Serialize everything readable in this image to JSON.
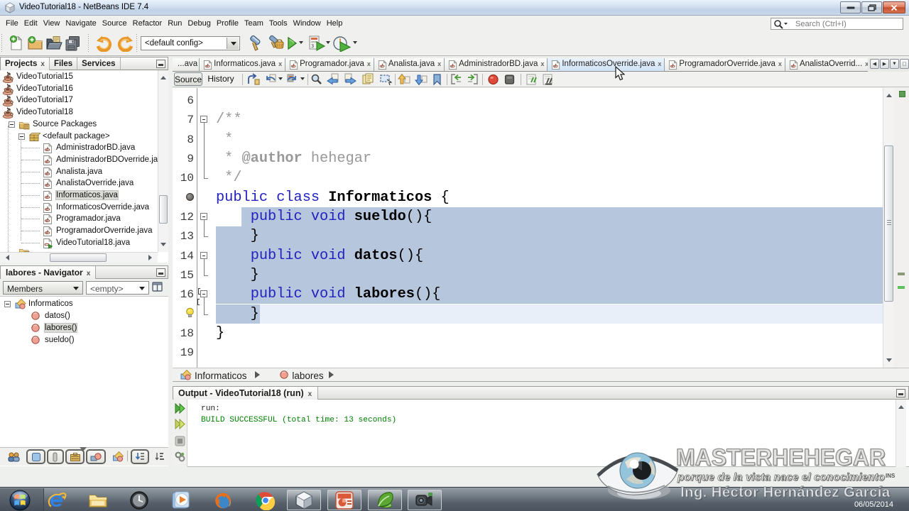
{
  "window": {
    "title": "VideoTutorial18 - NetBeans IDE 7.4",
    "search_placeholder": "Search (Ctrl+I)"
  },
  "menubar": {
    "items": [
      "File",
      "Edit",
      "View",
      "Navigate",
      "Source",
      "Refactor",
      "Run",
      "Debug",
      "Profile",
      "Team",
      "Tools",
      "Window",
      "Help"
    ]
  },
  "toolbar": {
    "config_value": "<default config>",
    "buttons": [
      "new-file",
      "new-project",
      "open-project",
      "save-all",
      "undo",
      "redo",
      "build-project",
      "clean-build-project",
      "run-project",
      "debug-project",
      "profile-project"
    ]
  },
  "projects_panel": {
    "tabs": [
      {
        "label": "Projects",
        "active": true,
        "closable": true
      },
      {
        "label": "Files",
        "active": false
      },
      {
        "label": "Services",
        "active": false
      }
    ],
    "tree": [
      {
        "label": "VideoTutorial15",
        "icon": "project",
        "indent": 3
      },
      {
        "label": "VideoTutorial16",
        "icon": "project",
        "indent": 3
      },
      {
        "label": "VideoTutorial17",
        "icon": "project",
        "indent": 3
      },
      {
        "label": "VideoTutorial18",
        "icon": "project",
        "indent": 3
      },
      {
        "label": "Source Packages",
        "icon": "srcfolder",
        "indent": 26,
        "expander": true
      },
      {
        "label": "<default package>",
        "icon": "package",
        "indent": 40,
        "expander": true
      },
      {
        "label": "AdministradorBD.java",
        "icon": "javafile",
        "indent": 59
      },
      {
        "label": "AdministradorBDOverride.java",
        "icon": "javafile",
        "indent": 59
      },
      {
        "label": "Analista.java",
        "icon": "javafile",
        "indent": 59
      },
      {
        "label": "AnalistaOverride.java",
        "icon": "javafile",
        "indent": 59
      },
      {
        "label": "Informaticos.java",
        "icon": "javafile",
        "indent": 59,
        "selected": true
      },
      {
        "label": "InformaticosOverride.java",
        "icon": "javafile",
        "indent": 59
      },
      {
        "label": "Programador.java",
        "icon": "javafile",
        "indent": 59
      },
      {
        "label": "ProgramadorOverride.java",
        "icon": "javafile",
        "indent": 59
      },
      {
        "label": "VideoTutorial18.java",
        "icon": "mainfile",
        "indent": 59
      },
      {
        "label": "",
        "icon": "srcfolder",
        "indent": 26
      }
    ]
  },
  "navigator": {
    "title": "labores - Navigator",
    "members_filter": "Members",
    "scope_filter": "<empty>",
    "tree": [
      {
        "label": "Informaticos",
        "icon": "class",
        "indent": 20,
        "expander": true
      },
      {
        "label": "datos()",
        "icon": "method",
        "indent": 43
      },
      {
        "label": "labores()",
        "icon": "method",
        "indent": 43,
        "selected": true
      },
      {
        "label": "sueldo()",
        "icon": "method",
        "indent": 43
      }
    ]
  },
  "doc_tabs": {
    "tabs": [
      {
        "label": "...ava",
        "partial": true
      },
      {
        "label": "Informaticos.java"
      },
      {
        "label": "Programador.java"
      },
      {
        "label": "Analista.java"
      },
      {
        "label": "AdministradorBD.java"
      },
      {
        "label": "InformaticosOverride.java",
        "active": true
      },
      {
        "label": "ProgramadorOverride.java"
      },
      {
        "label": "AnalistaOverrid..."
      }
    ]
  },
  "editor": {
    "source_button": "Source",
    "history_button": "History",
    "lines": [
      {
        "num": "6",
        "tokens": []
      },
      {
        "num": "7",
        "tokens": [
          {
            "t": "/**",
            "c": "cm"
          }
        ]
      },
      {
        "num": "8",
        "tokens": [
          {
            "t": " *",
            "c": "cm"
          }
        ]
      },
      {
        "num": "9",
        "tokens": [
          {
            "t": " * ",
            "c": "cm"
          },
          {
            "t": "@author",
            "c": "cmb"
          },
          {
            "t": " hehegar",
            "c": "cm"
          }
        ]
      },
      {
        "num": "10",
        "tokens": [
          {
            "t": " */",
            "c": "cm"
          }
        ]
      },
      {
        "num": "",
        "glyph": "annotation",
        "tokens": [
          {
            "t": "public",
            "c": "kw"
          },
          {
            "t": " ",
            "c": "pl"
          },
          {
            "t": "class",
            "c": "kw"
          },
          {
            "t": " ",
            "c": "pl"
          },
          {
            "t": "Informaticos",
            "c": "bd"
          },
          {
            "t": " {",
            "c": "pl"
          }
        ]
      },
      {
        "num": "12",
        "tokens": [
          {
            "t": "    ",
            "c": "pl"
          },
          {
            "t": "public",
            "c": "kw"
          },
          {
            "t": " ",
            "c": "pl"
          },
          {
            "t": "void",
            "c": "kw"
          },
          {
            "t": " ",
            "c": "pl"
          },
          {
            "t": "sueldo",
            "c": "bd"
          },
          {
            "t": "(){",
            "c": "pl"
          }
        ]
      },
      {
        "num": "13",
        "tokens": [
          {
            "t": "    }",
            "c": "pl"
          }
        ]
      },
      {
        "num": "14",
        "tokens": [
          {
            "t": "    ",
            "c": "pl"
          },
          {
            "t": "public",
            "c": "kw"
          },
          {
            "t": " ",
            "c": "pl"
          },
          {
            "t": "void",
            "c": "kw"
          },
          {
            "t": " ",
            "c": "pl"
          },
          {
            "t": "datos",
            "c": "bd"
          },
          {
            "t": "(){",
            "c": "pl"
          }
        ]
      },
      {
        "num": "15",
        "tokens": [
          {
            "t": "    }",
            "c": "pl"
          }
        ]
      },
      {
        "num": "16",
        "tokens": [
          {
            "t": "    ",
            "c": "pl"
          },
          {
            "t": "public",
            "c": "kw"
          },
          {
            "t": " ",
            "c": "pl"
          },
          {
            "t": "void",
            "c": "kw"
          },
          {
            "t": " ",
            "c": "pl"
          },
          {
            "t": "labores",
            "c": "bd"
          },
          {
            "t": "(){",
            "c": "pl"
          }
        ]
      },
      {
        "num": "",
        "glyph": "bulb",
        "tokens": [
          {
            "t": "    }",
            "c": "pl"
          }
        ]
      },
      {
        "num": "18",
        "tokens": [
          {
            "t": "}",
            "c": "pl"
          }
        ]
      },
      {
        "num": "19",
        "tokens": []
      }
    ],
    "folds": [
      [
        1,
        4
      ],
      [
        6,
        7
      ],
      [
        8,
        9
      ],
      [
        10,
        11
      ]
    ]
  },
  "breadcrumb": {
    "items": [
      {
        "label": "Informaticos",
        "icon": "class"
      },
      {
        "label": "labores",
        "icon": "method"
      }
    ]
  },
  "output": {
    "tab": "Output - VideoTutorial18 (run)",
    "lines": [
      {
        "text": "run:",
        "c": "plain"
      },
      {
        "text": "BUILD SUCCESSFUL (total time: 13 seconds)",
        "c": "success"
      }
    ]
  },
  "taskbar": {
    "date": "06/05/2014",
    "pinned_icons": [
      "internet-explorer",
      "windows-explorer",
      "clock",
      "media-player",
      "firefox",
      "chrome"
    ],
    "open_icons": [
      "netbeans",
      "powerpoint",
      "green-app",
      "camtasia"
    ]
  },
  "watermark": {
    "title": "MASTERHEHEGAR",
    "subtitle": "porque de la vista nace el conocimiento",
    "author": "Ing. Héctor Hernández García",
    "ins": "INS"
  },
  "colors": {
    "keyword": "#0000e6",
    "comment": "#999999",
    "selection": "#b6c6dd",
    "current_line": "#e9eff8",
    "build_success": "#008000",
    "selected_tab": "#cfe2f6"
  }
}
